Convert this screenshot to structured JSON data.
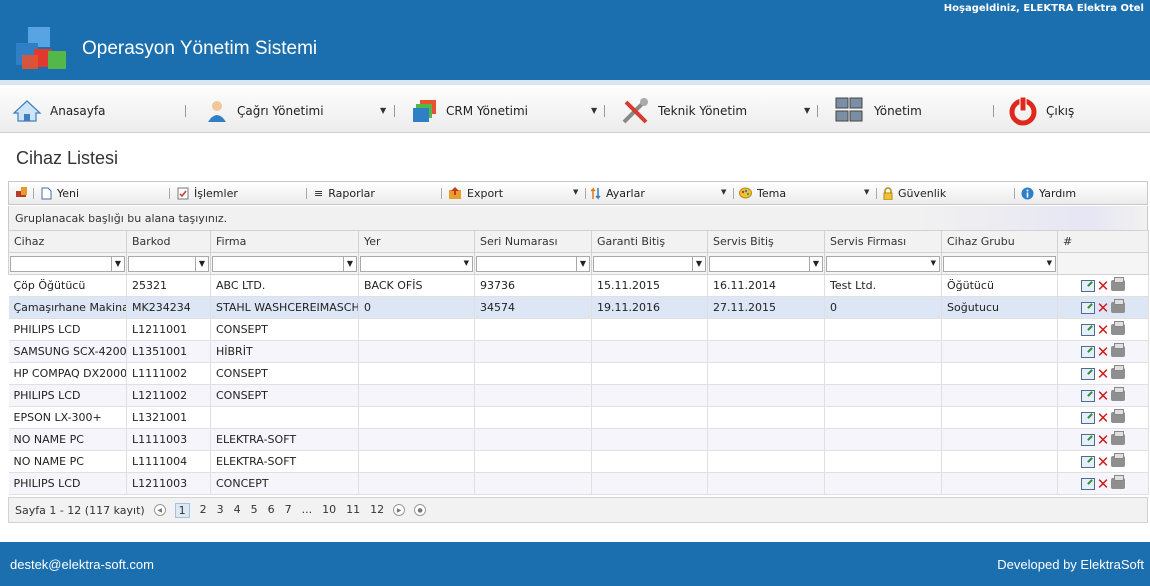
{
  "header": {
    "welcome": "Hoşageldiniz, ELEKTRA Elektra Otel",
    "app_title": "Operasyon Yönetim Sistemi"
  },
  "nav": {
    "home": "Anasayfa",
    "calls": "Çağrı Yönetimi",
    "crm": "CRM Yönetimi",
    "technical": "Teknik Yönetim",
    "management": "Yönetim",
    "logout": "Çıkış"
  },
  "page": {
    "title": "Cihaz Listesi"
  },
  "toolbar": {
    "new": "Yeni",
    "operations": "İşlemler",
    "reports": "Raporlar",
    "export": "Export",
    "settings": "Ayarlar",
    "theme": "Tema",
    "security": "Güvenlik",
    "help": "Yardım"
  },
  "grid": {
    "group_hint": "Gruplanacak başlığı bu alana taşıyınız.",
    "columns": [
      "Cihaz",
      "Barkod",
      "Firma",
      "Yer",
      "Seri Numarası",
      "Garanti Bitiş",
      "Servis Bitiş",
      "Servis Firması",
      "Cihaz Grubu",
      "#"
    ],
    "rows": [
      [
        "Çöp Öğütücü",
        "25321",
        "ABC LTD.",
        "BACK OFİS",
        "93736",
        "15.11.2015",
        "16.11.2014",
        "Test Ltd.",
        "Öğütücü"
      ],
      [
        "Çamaşırhane Makinal",
        "MK234234",
        "STAHL WASHCEREIMASCHI",
        "0",
        "34574",
        "19.11.2016",
        "27.11.2015",
        "0",
        "Soğutucu"
      ],
      [
        "PHILIPS LCD",
        "L1211001",
        "CONSEPT",
        "",
        "",
        "",
        "",
        "",
        ""
      ],
      [
        "SAMSUNG SCX-4200",
        "L1351001",
        "HİBRİT",
        "",
        "",
        "",
        "",
        "",
        ""
      ],
      [
        "HP COMPAQ DX2000",
        "L1111002",
        "CONSEPT",
        "",
        "",
        "",
        "",
        "",
        ""
      ],
      [
        "PHILIPS LCD",
        "L1211002",
        "CONSEPT",
        "",
        "",
        "",
        "",
        "",
        ""
      ],
      [
        "EPSON LX-300+",
        "L1321001",
        "",
        "",
        "",
        "",
        "",
        "",
        ""
      ],
      [
        "NO NAME PC",
        "L1111003",
        "ELEKTRA-SOFT",
        "",
        "",
        "",
        "",
        "",
        ""
      ],
      [
        "NO NAME PC",
        "L1111004",
        "ELEKTRA-SOFT",
        "",
        "",
        "",
        "",
        "",
        ""
      ],
      [
        "PHILIPS LCD",
        "L1211003",
        "CONCEPT",
        "",
        "",
        "",
        "",
        "",
        ""
      ]
    ]
  },
  "pager": {
    "summary": "Sayfa 1 - 12 (117 kayıt)",
    "pages": [
      "1",
      "2",
      "3",
      "4",
      "5",
      "6",
      "7",
      "...",
      "10",
      "11",
      "12"
    ],
    "current": "1"
  },
  "footer": {
    "email": "destek@elektra-soft.com",
    "credit": "Developed by ElektraSoft"
  },
  "colors": {
    "brand": "#1b6fae",
    "selected_row": "#dce6f4",
    "delete_icon": "#d21b1b"
  }
}
